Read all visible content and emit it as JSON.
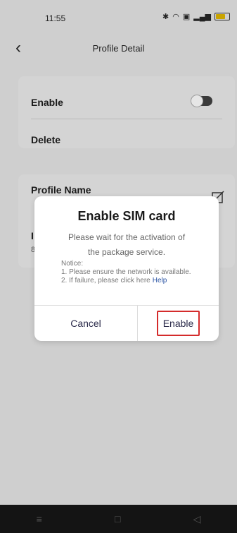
{
  "status_bar": {
    "time": "11:55",
    "battery_label": "65"
  },
  "header": {
    "title": "Profile Detail"
  },
  "settings": {
    "enable_label": "Enable",
    "delete_label": "Delete",
    "profile_name_label": "Profile Name",
    "partial_row_letter": "I",
    "partial_row_number": "8"
  },
  "dialog": {
    "title": "Enable SIM card",
    "message_line1": "Please wait for the activation of",
    "message_line2": "the package service.",
    "notice_heading": "Notice:",
    "notice_line1": "1. Please ensure the network is available.",
    "notice_line2": "2. If failure, please click here",
    "help_link": "Help",
    "cancel_label": "Cancel",
    "enable_label": "Enable"
  },
  "navbar": {
    "menu_icon": "≡",
    "home_icon": "□",
    "back_icon": "◁"
  },
  "colors": {
    "highlight": "#d42b2b",
    "link": "#2c54a4"
  }
}
